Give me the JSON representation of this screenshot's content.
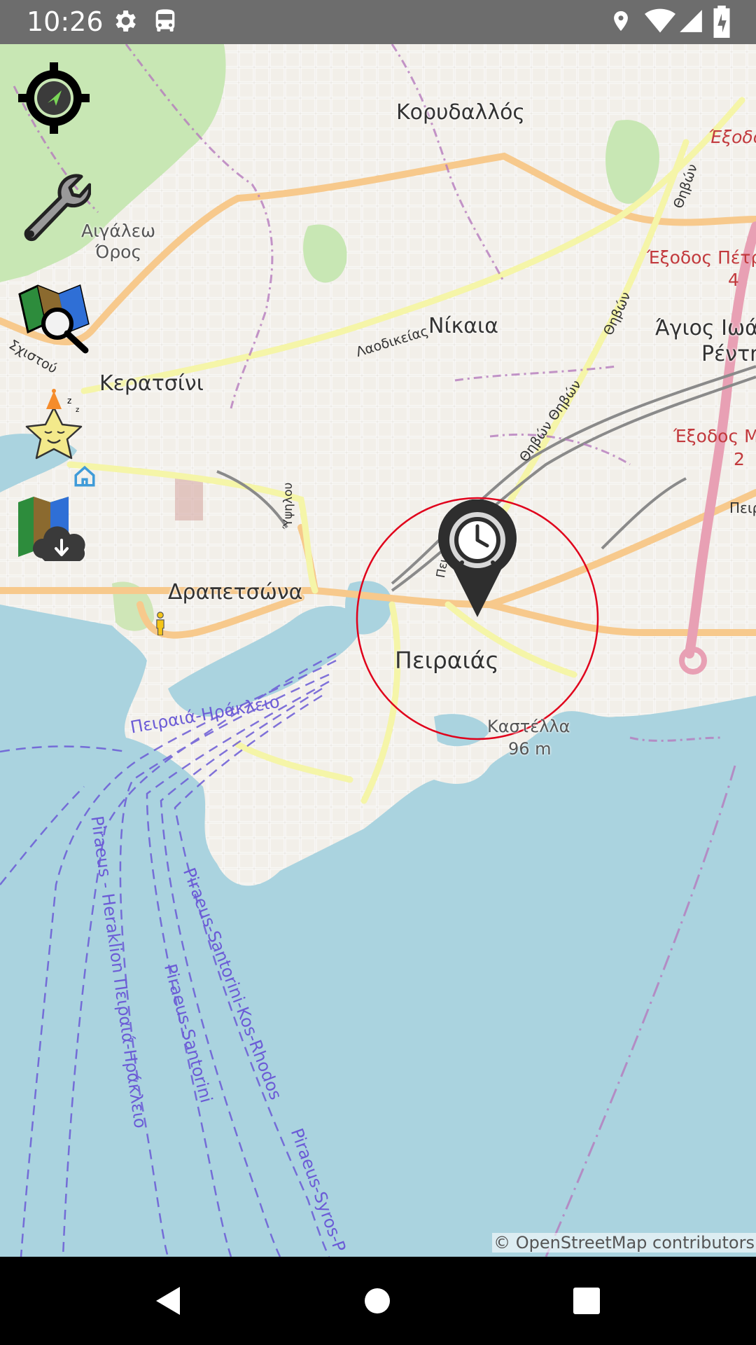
{
  "status_bar": {
    "time": "10:26",
    "left_icons": [
      "gear-icon",
      "bus-icon"
    ],
    "right_icons": [
      "location-icon",
      "wifi-icon",
      "signal-icon",
      "battery-charging-icon"
    ]
  },
  "map": {
    "attribution": "© OpenStreetMap contributors",
    "colors": {
      "sea": "#aad3df",
      "land": "#f2efe9",
      "park": "#c8e7b4",
      "primary_road": "#f7c98c",
      "secondary_road": "#f5f5a8",
      "motorway": "#e8a0b4",
      "boundary": "#b57bbd",
      "ferry": "#6b5bd6",
      "marker_circle": "#e0001b"
    },
    "place_labels": {
      "korydallos": "Κορυδαλλός",
      "aigaleo": "Αιγάλεω",
      "oros": "Όρος",
      "nikaia": "Νίκαια",
      "keratsini": "Κερατσίνι",
      "agios_ioannis": "Άγιος Ιωά",
      "rentis": "Ρέντη",
      "drapetsona": "Δραπετσώνα",
      "peiraias": "Πειραιάς",
      "kastella": "Καστέλλα",
      "kastella_elev": "96 m"
    },
    "exit_labels": {
      "exit1": "Έξοδο",
      "exit2": "Έξοδος Πέτρ",
      "exit2_num": "4",
      "exit3": "Έξοδος Μ",
      "exit3_num": "2",
      "peir": "Πειρ"
    },
    "road_labels": {
      "laodikeias": "Λαοδικείας",
      "thivon1": "Θηβών",
      "thivon2": "Θηβών",
      "thivon3": "Θηβών Θηβών",
      "schistou": "Σχιστού",
      "ypsilou": "Ύψηλου",
      "pireos": "Πειρ"
    },
    "sea_labels": {
      "l1": "Πειραιά-Ηράκλειο",
      "l2": "Piraeus - Heraklion Πειραιά-Ηράκλειο",
      "l3": "Piraeus-Santorini-Kos-Rhodos",
      "l4": "Piraeus-Santorini",
      "l5": "Piraeus-Syros-P"
    }
  },
  "toolbar": {
    "buttons": [
      {
        "name": "locate-button",
        "icon": "crosshair-compass-icon"
      },
      {
        "name": "settings-button",
        "icon": "wrench-icon"
      },
      {
        "name": "map-search-button",
        "icon": "map-search-icon"
      },
      {
        "name": "sleep-button",
        "icon": "sleepy-star-icon"
      },
      {
        "name": "offline-maps-button",
        "icon": "map-download-icon"
      }
    ]
  },
  "marker": {
    "icon": "alarm-clock-pin-icon"
  },
  "nav_bar": {
    "buttons": [
      "back-icon",
      "home-icon",
      "recents-icon"
    ]
  }
}
